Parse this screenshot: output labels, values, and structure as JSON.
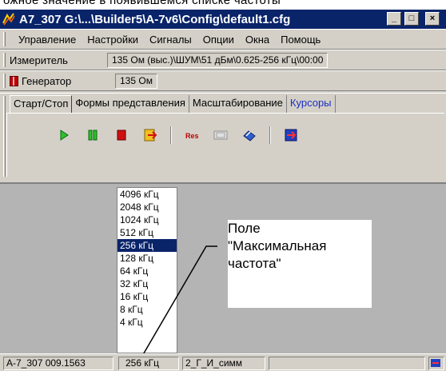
{
  "top_text": "ожное значение в появившемся списке частоты",
  "window": {
    "title": "А7_307 G:\\...\\Builder5\\A-7v6\\Config\\default1.cfg",
    "controls": [
      "_",
      "□",
      "×"
    ]
  },
  "menu": {
    "items": [
      "Управление",
      "Настройки",
      "Сигналы",
      "Опции",
      "Окна",
      "Помощь"
    ]
  },
  "meter": {
    "label": "Измеритель",
    "value": "135 Ом (выс.)\\ШУМ\\51 дБм\\0.625-256 кГц\\00:00"
  },
  "generator": {
    "label": "Генератор",
    "value": "135 Ом"
  },
  "tabs": [
    {
      "label": "Старт/Стоп",
      "active": true
    },
    {
      "label": "Формы представления",
      "active": false
    },
    {
      "label": "Масштабирование",
      "active": false
    },
    {
      "label": "Курсоры",
      "active": false
    }
  ],
  "toolbar": {
    "icons": [
      "play-icon",
      "pause-icon",
      "stop-icon",
      "export-icon",
      "reset-icon",
      "display-icon",
      "eraser-icon",
      "exit-icon"
    ],
    "reset_text": "Res"
  },
  "freq_list": {
    "items": [
      "4096 кГц",
      "2048 кГц",
      "1024 кГц",
      "512 кГц",
      "256 кГц",
      "128 кГц",
      "64 кГц",
      "32 кГц",
      "16 кГц",
      "8 кГц",
      "4 кГц"
    ],
    "selected": "256 кГц"
  },
  "callout": {
    "text": "Поле\n\"Максимальная\nчастота\""
  },
  "statusbar": {
    "device": "А-7_307 009.1563",
    "max_freq": "256 кГц",
    "mode": "2_Г_И_симм"
  }
}
